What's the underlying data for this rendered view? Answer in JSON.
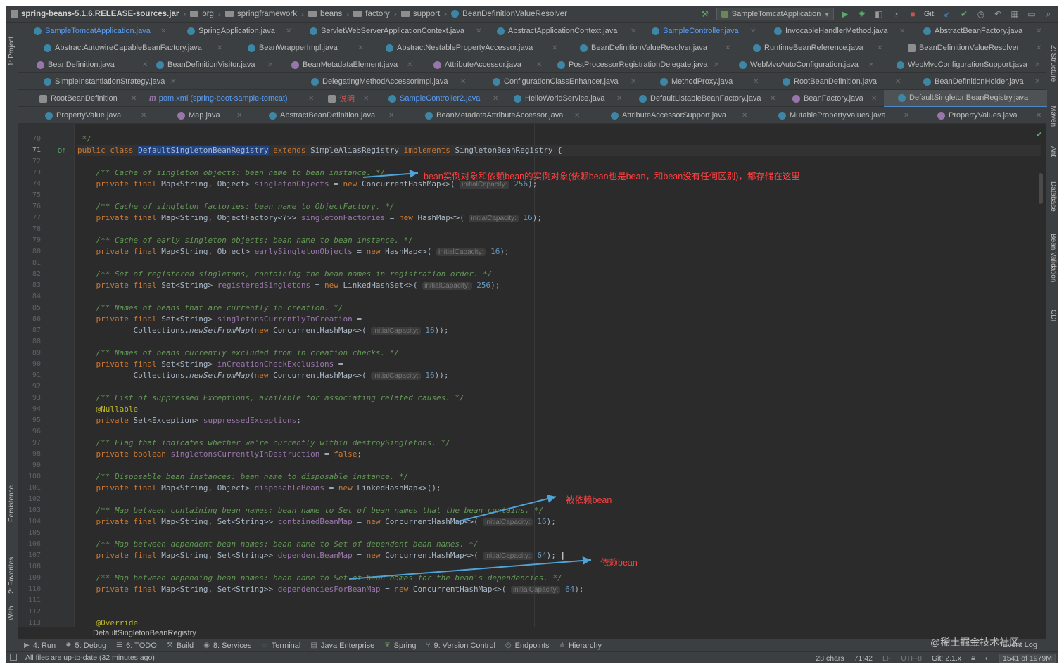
{
  "navbar": {
    "jar": "spring-beans-5.1.6.RELEASE-sources.jar",
    "crumbs": [
      "org",
      "springframework",
      "beans",
      "factory",
      "support"
    ],
    "class_crumb": "BeanDefinitionValueResolver",
    "run_config": "SampleTomcatApplication",
    "git_label": "Git:"
  },
  "tabs": {
    "row1": [
      "SampleTomcatApplication.java",
      "SpringApplication.java",
      "ServletWebServerApplicationContext.java",
      "AbstractApplicationContext.java",
      "SampleController.java",
      "InvocableHandlerMethod.java",
      "AbstractBeanFactory.java"
    ],
    "row2": [
      "AbstractAutowireCapableBeanFactory.java",
      "BeanWrapperImpl.java",
      "AbstractNestablePropertyAccessor.java",
      "BeanDefinitionValueResolver.java",
      "RuntimeBeanReference.java",
      "BeanDefinitionValueResolver"
    ],
    "row3": [
      "BeanDefinition.java",
      "BeanDefinitionVisitor.java",
      "BeanMetadataElement.java",
      "AttributeAccessor.java",
      "PostProcessorRegistrationDelegate.java",
      "WebMvcAutoConfiguration.java",
      "WebMvcConfigurationSupport.java"
    ],
    "row4": [
      "SimpleInstantiationStrategy.java",
      "DelegatingMethodAccessorImpl.java",
      "ConfigurationClassEnhancer.java",
      "MethodProxy.java",
      "RootBeanDefinition.java",
      "BeanDefinitionHolder.java"
    ],
    "row5": [
      "RootBeanDefinition",
      "pom.xml (spring-boot-sample-tomcat)",
      "说明",
      "SampleController2.java",
      "HelloWorldService.java",
      "DefaultListableBeanFactory.java",
      "BeanFactory.java",
      "DefaultSingletonBeanRegistry.java"
    ],
    "row6": [
      "PropertyValue.java",
      "Map.java",
      "AbstractBeanDefinition.java",
      "BeanMetadataAttributeAccessor.java",
      "AttributeAccessorSupport.java",
      "MutablePropertyValues.java",
      "PropertyValues.java"
    ]
  },
  "left_strip": {
    "project": "1: Project",
    "persistence": "Persistence",
    "favorites": "2: Favorites",
    "web": "Web"
  },
  "right_strip": {
    "structure": "Z: Structure",
    "maven": "Maven",
    "ant": "Ant",
    "database": "Database",
    "bean_validation": "Bean Validation",
    "cdi": "CDI"
  },
  "code": {
    "line_numbers": [
      "70",
      "71",
      "72",
      "73",
      "74",
      "75",
      "76",
      "77",
      "78",
      "79",
      "80",
      "81",
      "82",
      "83",
      "84",
      "85",
      "86",
      "87",
      "88",
      "89",
      "90",
      "91",
      "92",
      "93",
      "94",
      "95",
      "96",
      "97",
      "98",
      "99",
      "100",
      "101",
      "102",
      "103",
      "104",
      "105",
      "106",
      "107",
      "108",
      "109",
      "110",
      "111",
      "112",
      "113"
    ],
    "line70": " */",
    "class_decl": {
      "kw1": "public class ",
      "name": "DefaultSingletonBeanRegistry",
      "kw2": " extends ",
      "parent": "SimpleAliasRegistry",
      "kw3": " implements ",
      "iface": "SingletonBeanRegistry {"
    },
    "c73": "/** Cache of singleton objects: bean name to bean instance. */",
    "c76": "/** Cache of singleton factories: bean name to ObjectFactory. */",
    "c79": "/** Cache of early singleton objects: bean name to bean instance. */",
    "c82": "/** Set of registered singletons, containing the bean names in registration order. */",
    "c85": "/** Names of beans that are currently in creation. */",
    "c89": "/** Names of beans currently excluded from in creation checks. */",
    "c93": "/** List of suppressed Exceptions, available for associating related causes. */",
    "c97": "/** Flag that indicates whether we're currently within destroySingletons. */",
    "c100": "/** Disposable bean instances: bean name to disposable instance. */",
    "c103": "/** Map between containing bean names: bean name to Set of bean names that the bean contains. */",
    "c106": "/** Map between dependent bean names: bean name to Set of dependent bean names. */",
    "c109": "/** Map between depending bean names: bean name to Set of bean names for the bean's dependencies. */",
    "nullable": "@Nullable",
    "override": "@Override",
    "hint_label": "initialCapacity:"
  },
  "annotations": {
    "a1": "bean实例对象和依赖bean的实例对象(依赖bean也是bean，和bean没有任何区别)，都存储在这里",
    "a2": "被依赖bean",
    "a3": "依赖bean"
  },
  "editor_breadcrumb": "DefaultSingletonBeanRegistry",
  "tool_windows": [
    "4: Run",
    "5: Debug",
    "6: TODO",
    "Build",
    "8: Services",
    "Terminal",
    "Java Enterprise",
    "Spring",
    "9: Version Control",
    "Endpoints",
    "Hierarchy"
  ],
  "event_log": "Event Log",
  "status": {
    "message": "All files are up-to-date (32 minutes ago)",
    "chars": "28 chars",
    "position": "71:42",
    "line_sep": "LF",
    "encoding": "UTF-8",
    "git": "Git: 2.1.x",
    "memory": "1541 of 1979M"
  },
  "watermark": "@稀土掘金技术社区",
  "colors": {
    "keyword": "#cc7832",
    "comment": "#629755",
    "field": "#9876aa",
    "annotation": "#ff4040",
    "arrow": "#4fa3d6"
  }
}
